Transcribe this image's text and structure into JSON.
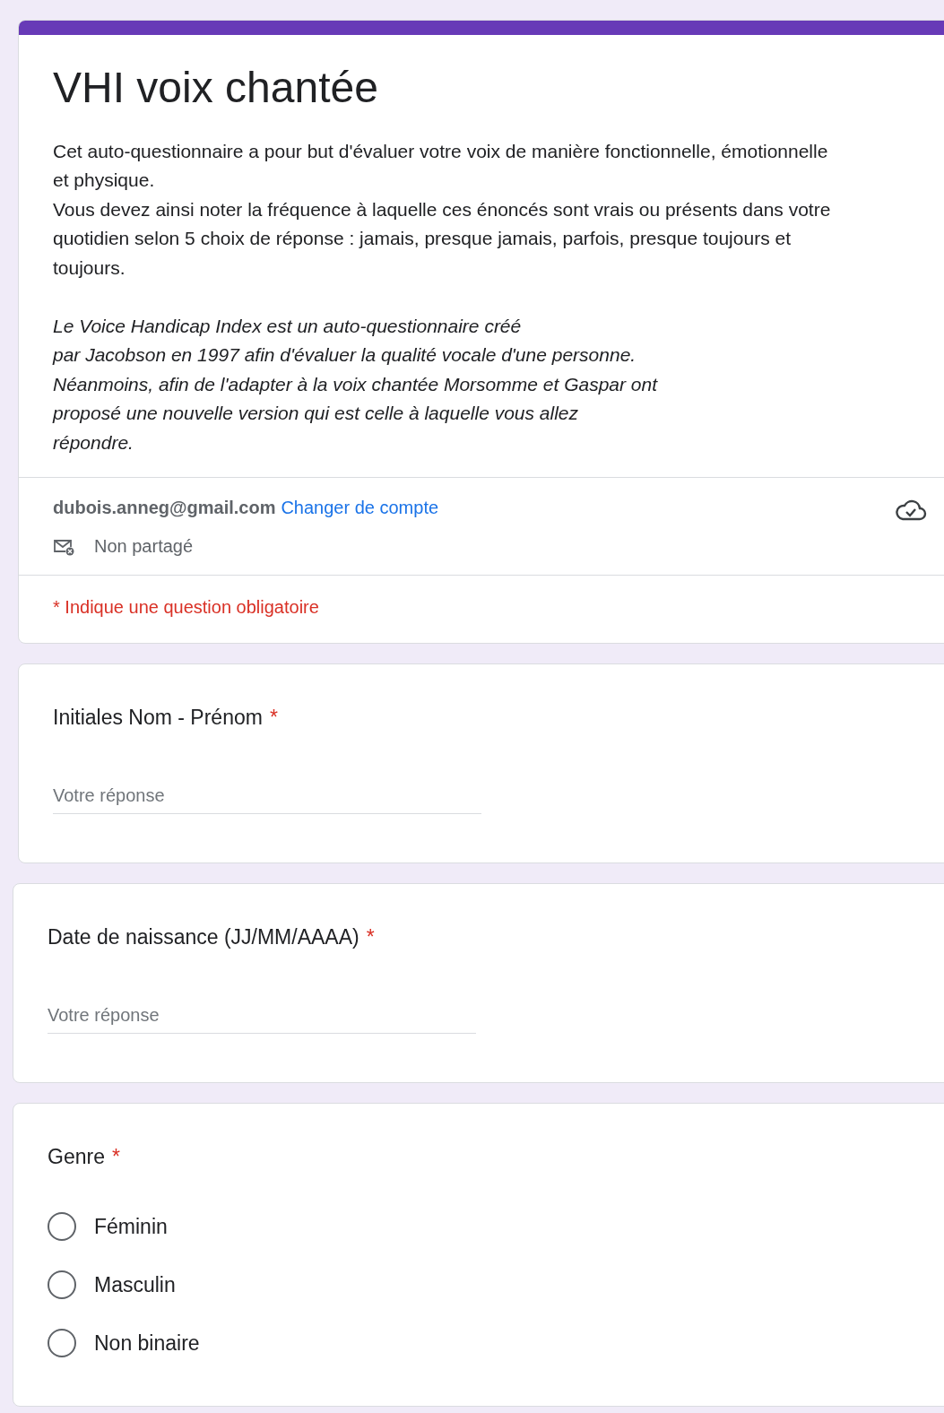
{
  "form": {
    "title": "VHI voix chantée",
    "description": [
      {
        "kind": "body",
        "lines": [
          "Cet auto-questionnaire a pour but d'évaluer votre voix de manière fonctionnelle, émotionnelle et physique.",
          "Vous devez ainsi noter la fréquence à laquelle ces énoncés sont vrais ou présents dans votre quotidien selon 5 choix de réponse : jamais, presque jamais, parfois, presque toujours et toujours."
        ]
      },
      {
        "kind": "note",
        "lines": [
          "Le Voice Handicap Index est un auto-questionnaire créé",
          "par Jacobson en 1997 afin d'évaluer la qualité vocale d'une personne.",
          "Néanmoins, afin de l'adapter à la voix chantée Morsomme et Gaspar ont",
          "proposé une nouvelle version qui est celle à laquelle vous allez",
          "répondre."
        ]
      }
    ],
    "account": {
      "email": "dubois.anneg@gmail.com",
      "switch_link": "Changer de compte",
      "sharing": "Non partagé"
    },
    "required_note": "* Indique une question obligatoire"
  },
  "questions": [
    {
      "kind": "text",
      "title": "Initiales Nom - Prénom",
      "required_mark": "*",
      "placeholder": "Votre réponse"
    },
    {
      "kind": "text",
      "title": "Date de naissance (JJ/MM/AAAA)",
      "required_mark": "*",
      "placeholder": "Votre réponse"
    },
    {
      "kind": "radio",
      "title": "Genre",
      "required_mark": "*",
      "options": [
        {
          "label": "Féminin",
          "selected": false
        },
        {
          "label": "Masculin",
          "selected": false
        },
        {
          "label": "Non binaire",
          "selected": false
        }
      ]
    }
  ]
}
